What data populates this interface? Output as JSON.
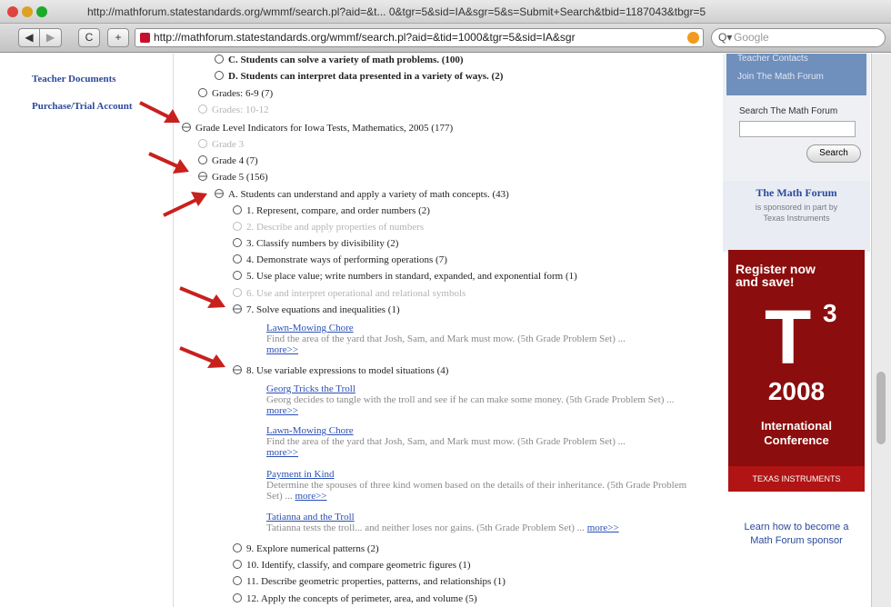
{
  "window": {
    "title": "http://mathforum.statestandards.org/wmmf/search.pl?aid=&t... 0&tgr=5&sid=IA&sgr=5&s=Submit+Search&tbid=1187043&tbgr=5"
  },
  "toolbar": {
    "back": "◀",
    "forward": "▶",
    "reload": "C",
    "add": "+",
    "url": "http://mathforum.statestandards.org/wmmf/search.pl?aid=&tid=1000&tgr=5&sid=IA&sgr",
    "search_placeholder": "Google"
  },
  "left_nav": {
    "teacher_documents": "Teacher Documents",
    "purchase": "Purchase/Trial Account"
  },
  "tree": {
    "c_item": "C. Students can solve a variety of math problems. (100)",
    "d_item": "D. Students can interpret data presented in a variety of ways. (2)",
    "grades_6_9": "Grades: 6-9 (7)",
    "grades_10_12": "Grades: 10-12",
    "gli": "Grade Level Indicators for Iowa Tests, Mathematics, 2005 (177)",
    "grade3": "Grade 3",
    "grade4": "Grade 4 (7)",
    "grade5": "Grade 5 (156)",
    "a_item": "A. Students can understand and apply a variety of math concepts. (43)",
    "i1": "1. Represent, compare, and order numbers (2)",
    "i2": "2. Describe and apply properties of numbers",
    "i3": "3. Classify numbers by divisibility (2)",
    "i4": "4. Demonstrate ways of performing operations (7)",
    "i5": "5. Use place value; write numbers in standard, expanded, and exponential form (1)",
    "i6": "6. Use and interpret operational and relational symbols",
    "i7": "7. Solve equations and inequalities (1)",
    "i8": "8. Use variable expressions to model situations (4)",
    "i9": "9. Explore numerical patterns (2)",
    "i10": "10. Identify, classify, and compare geometric figures (1)",
    "i11": "11. Describe geometric properties, patterns, and relationships (1)",
    "i12": "12. Apply the concepts of perimeter, area, and volume (5)"
  },
  "results": {
    "r1_title": "Lawn-Mowing Chore",
    "r1_desc": "Find the area of the yard that Josh, Sam, and Mark must mow. (5th Grade Problem Set) ...",
    "more": "more>>",
    "r2_title": "Georg Tricks the Troll",
    "r2_desc": "Georg decides to tangle with the troll and see if he can make some money. (5th Grade Problem Set) ...",
    "r3_title": "Lawn-Mowing Chore",
    "r3_desc": "Find the area of the yard that Josh, Sam, and Mark must mow. (5th Grade Problem Set) ...",
    "r4_title": "Payment in Kind",
    "r4_desc": "Determine the spouses of three kind women based on the details of their inheritance. (5th Grade Problem Set) ...",
    "r5_title": "Tatianna and the Troll",
    "r5_desc": "Tatianna tests the troll... and neither loses nor gains. (5th Grade Problem Set) ..."
  },
  "right": {
    "teacher_contacts": "Teacher Contacts",
    "join": "Join The Math Forum",
    "search_label": "Search The Math Forum",
    "search_button": "Search",
    "mf_title": "The Math Forum",
    "mf_sub1": "is sponsored in part by",
    "mf_sub2": "Texas Instruments",
    "ad_head1": "Register now",
    "ad_head2": "and save!",
    "ad_t": "T",
    "ad_3": "3",
    "ad_year": "2008",
    "ad_conf1": "International",
    "ad_conf2": "Conference",
    "ad_foot": "TEXAS INSTRUMENTS",
    "learn1": "Learn how to become a",
    "learn2": "Math Forum sponsor"
  },
  "colors": {
    "annotation_arrow": "#c8201e",
    "link": "#2a4fb5",
    "ad_red": "#8b0d0d"
  }
}
